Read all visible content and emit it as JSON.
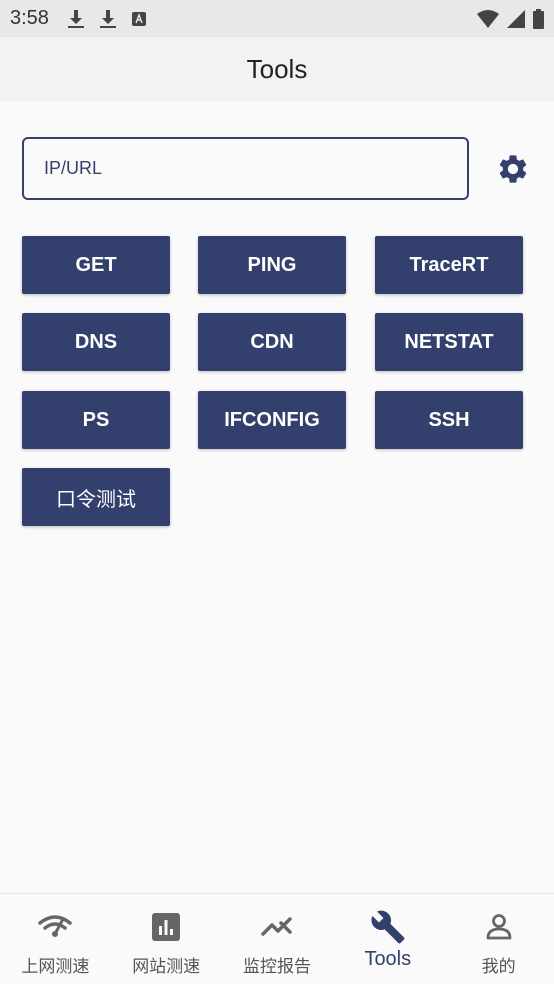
{
  "status_bar": {
    "time": "3:58",
    "icons": [
      "download-icon",
      "download-icon",
      "a-box-icon",
      "wifi-icon",
      "signal-icon",
      "battery-icon"
    ]
  },
  "app_bar": {
    "title": "Tools"
  },
  "target_input": {
    "placeholder": "IP/URL",
    "value": ""
  },
  "settings": {
    "icon": "gear-icon"
  },
  "tools": [
    {
      "label": "GET"
    },
    {
      "label": "PING"
    },
    {
      "label": "TraceRT"
    },
    {
      "label": "DNS"
    },
    {
      "label": "CDN"
    },
    {
      "label": "NETSTAT"
    },
    {
      "label": "PS"
    },
    {
      "label": "IFCONFIG"
    },
    {
      "label": "SSH"
    },
    {
      "label": "口令测试"
    }
  ],
  "bottom_nav": {
    "items": [
      {
        "label": "上网测速",
        "icon": "wifi-speed-icon"
      },
      {
        "label": "网站测速",
        "icon": "bar-chart-icon"
      },
      {
        "label": "监控报告",
        "icon": "trend-icon"
      },
      {
        "label": "Tools",
        "icon": "wrench-icon",
        "active": true
      },
      {
        "label": "我的",
        "icon": "person-icon"
      }
    ]
  },
  "colors": {
    "primary": "#333f6c",
    "status_bar_bg": "#e8e8e8",
    "app_bar_bg": "#f2f2f2",
    "background": "#fafafa"
  }
}
